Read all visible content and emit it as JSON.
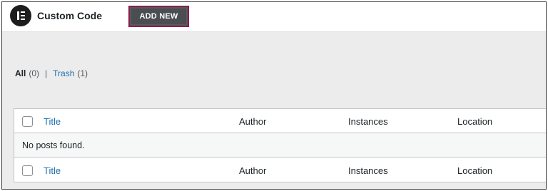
{
  "header": {
    "logo_icon": "elementor-logo-icon",
    "title": "Custom Code",
    "add_new_label": "ADD NEW",
    "add_new_border_color": "#8c1c4f"
  },
  "filters": {
    "all_label": "All",
    "all_count": "(0)",
    "separator": "|",
    "trash_label": "Trash",
    "trash_count": "(1)"
  },
  "table": {
    "columns": [
      "Title",
      "Author",
      "Instances",
      "Location"
    ],
    "empty_message": "No posts found.",
    "footer_columns": [
      "Title",
      "Author",
      "Instances",
      "Location"
    ]
  }
}
